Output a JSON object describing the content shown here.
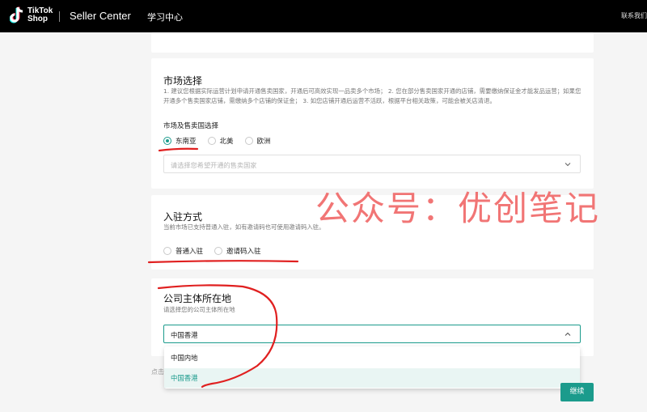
{
  "header": {
    "logo_line1": "TikTok",
    "logo_line2": "Shop",
    "brand": "Seller Center",
    "nav_study": "学习中心",
    "contact": "联系我们"
  },
  "market": {
    "title": "市场选择",
    "desc": "1. 建议您根据实际运营计划申请开通售卖国家，开通后可高效实现一品卖多个市场； 2. 您在部分售卖国家开通的店铺，需要缴纳保证金才能发品运营；如果您开通多个售卖国家店铺，需缴纳多个店铺的保证金； 3. 如您店铺开通后运营不活跃，根据平台相关政策，可能会被关店清退。",
    "field_label": "市场及售卖国选择",
    "options": [
      "东南亚",
      "北美",
      "欧洲"
    ],
    "selected": "东南亚",
    "country_placeholder": "请选择您希望开通的售卖国家"
  },
  "entry": {
    "title": "入驻方式",
    "desc": "当前市场已支持普通入驻，如有邀请码也可使用邀请码入驻。",
    "options": [
      "普通入驻",
      "邀请码入驻"
    ]
  },
  "company": {
    "title": "公司主体所在地",
    "desc": "请选择您的公司主体所在地",
    "value": "中国香港",
    "dropdown_options": [
      "中国内地",
      "中国香港"
    ],
    "highlighted": "中国香港"
  },
  "footer": {
    "hint_prefix": "点击",
    "next_label": "继续"
  },
  "watermark": "公众号：优创笔记",
  "colors": {
    "accent": "#1b9b8c",
    "annotation": "#e02020",
    "watermark": "#f06a6a"
  }
}
